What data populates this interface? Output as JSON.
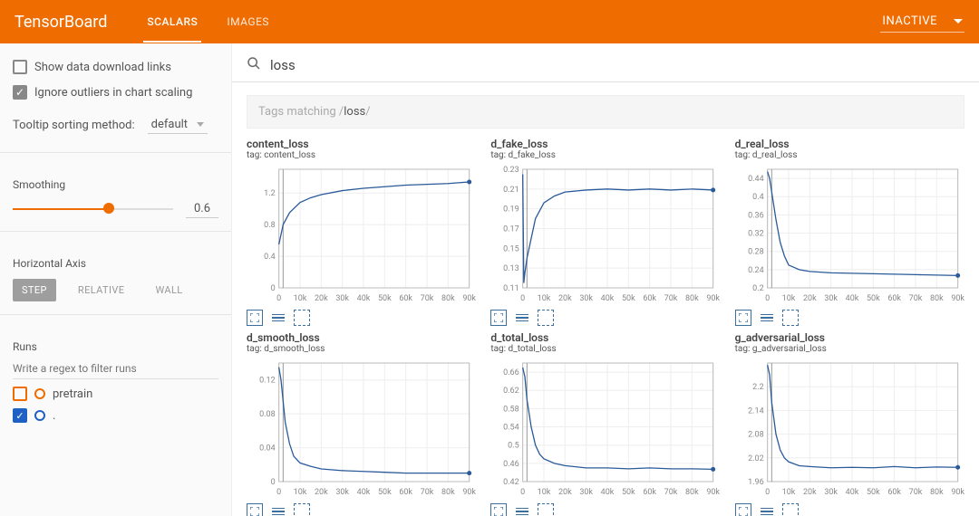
{
  "header": {
    "logo": "TensorBoard",
    "tabs": [
      {
        "label": "SCALARS",
        "active": true
      },
      {
        "label": "IMAGES",
        "active": false
      }
    ],
    "dropdown": "INACTIVE"
  },
  "sidebar": {
    "download_links": {
      "label": "Show data download links",
      "checked": false
    },
    "ignore_outliers": {
      "label": "Ignore outliers in chart scaling",
      "checked": true
    },
    "tooltip_label": "Tooltip sorting method:",
    "tooltip_value": "default",
    "smoothing_label": "Smoothing",
    "smoothing_value": "0.6",
    "smoothing_pct": 60,
    "horiz_label": "Horizontal Axis",
    "axis_options": [
      {
        "label": "STEP",
        "active": true
      },
      {
        "label": "RELATIVE",
        "active": false
      },
      {
        "label": "WALL",
        "active": false
      }
    ],
    "runs_label": "Runs",
    "runs_filter_placeholder": "Write a regex to filter runs",
    "runs": [
      {
        "name": "pretrain",
        "color": "orange",
        "checked": false
      },
      {
        "name": ".",
        "color": "blue",
        "checked": true
      }
    ]
  },
  "search": {
    "value": "loss"
  },
  "tagbar": {
    "prefix": "Tags matching /",
    "query": "loss",
    "suffix": "/"
  },
  "x_ticks": [
    "0",
    "10k",
    "20k",
    "30k",
    "40k",
    "50k",
    "60k",
    "70k",
    "80k",
    "90k"
  ],
  "chart_data": [
    {
      "title": "content_loss",
      "tag": "tag: content_loss",
      "type": "line",
      "xlabel": "",
      "ylabel": "",
      "x_ticks": [
        "0",
        "10k",
        "20k",
        "30k",
        "40k",
        "50k",
        "60k",
        "70k",
        "80k",
        "90k"
      ],
      "y_ticks": [
        "0",
        "0.4",
        "0.8",
        "1.2"
      ],
      "ylim": [
        0,
        1.5
      ],
      "x": [
        0,
        2,
        5,
        10,
        15,
        20,
        30,
        40,
        50,
        60,
        70,
        80,
        90
      ],
      "values": [
        0.55,
        0.8,
        0.95,
        1.08,
        1.14,
        1.18,
        1.23,
        1.26,
        1.28,
        1.3,
        1.31,
        1.32,
        1.34
      ]
    },
    {
      "title": "d_fake_loss",
      "tag": "tag: d_fake_loss",
      "type": "line",
      "x_ticks": [
        "0",
        "10k",
        "20k",
        "30k",
        "40k",
        "50k",
        "60k",
        "70k",
        "80k",
        "90k"
      ],
      "y_ticks": [
        "0.11",
        "0.13",
        "0.15",
        "0.17",
        "0.19",
        "0.21",
        "0.23"
      ],
      "ylim": [
        0.11,
        0.23
      ],
      "x": [
        0,
        0.5,
        1,
        2,
        4,
        6,
        10,
        15,
        20,
        30,
        40,
        50,
        60,
        70,
        80,
        90
      ],
      "values": [
        0.225,
        0.115,
        0.125,
        0.14,
        0.16,
        0.18,
        0.196,
        0.203,
        0.207,
        0.209,
        0.21,
        0.209,
        0.21,
        0.209,
        0.21,
        0.209
      ]
    },
    {
      "title": "d_real_loss",
      "tag": "tag: d_real_loss",
      "type": "line",
      "x_ticks": [
        "0",
        "10k",
        "20k",
        "30k",
        "40k",
        "50k",
        "60k",
        "70k",
        "80k",
        "90k"
      ],
      "y_ticks": [
        "0.2",
        "0.24",
        "0.28",
        "0.32",
        "0.36",
        "0.4",
        "0.44"
      ],
      "ylim": [
        0.2,
        0.46
      ],
      "x": [
        0,
        1,
        2,
        4,
        6,
        8,
        10,
        15,
        20,
        30,
        40,
        50,
        60,
        70,
        80,
        90
      ],
      "values": [
        0.455,
        0.44,
        0.41,
        0.35,
        0.3,
        0.27,
        0.25,
        0.24,
        0.236,
        0.233,
        0.232,
        0.231,
        0.23,
        0.229,
        0.228,
        0.227
      ]
    },
    {
      "title": "d_smooth_loss",
      "tag": "tag: d_smooth_loss",
      "type": "line",
      "x_ticks": [
        "0",
        "10k",
        "20k",
        "30k",
        "40k",
        "50k",
        "60k",
        "70k",
        "80k",
        "90k"
      ],
      "y_ticks": [
        "0",
        "0.04",
        "0.08",
        "0.12"
      ],
      "ylim": [
        0,
        0.14
      ],
      "x": [
        0,
        1,
        2,
        3,
        5,
        7,
        10,
        15,
        20,
        30,
        40,
        50,
        60,
        70,
        80,
        90
      ],
      "values": [
        0.135,
        0.12,
        0.095,
        0.07,
        0.045,
        0.03,
        0.022,
        0.018,
        0.015,
        0.013,
        0.012,
        0.011,
        0.01,
        0.01,
        0.01,
        0.01
      ]
    },
    {
      "title": "d_total_loss",
      "tag": "tag: d_total_loss",
      "type": "line",
      "x_ticks": [
        "0",
        "10k",
        "20k",
        "30k",
        "40k",
        "50k",
        "60k",
        "70k",
        "80k",
        "90k"
      ],
      "y_ticks": [
        "0.42",
        "0.46",
        "0.5",
        "0.54",
        "0.58",
        "0.62",
        "0.66"
      ],
      "ylim": [
        0.42,
        0.68
      ],
      "x": [
        0,
        1,
        2,
        4,
        6,
        8,
        10,
        15,
        20,
        30,
        40,
        50,
        60,
        70,
        80,
        90
      ],
      "values": [
        0.67,
        0.65,
        0.6,
        0.54,
        0.5,
        0.48,
        0.47,
        0.46,
        0.455,
        0.45,
        0.45,
        0.448,
        0.45,
        0.448,
        0.448,
        0.447
      ]
    },
    {
      "title": "g_adversarial_loss",
      "tag": "tag: g_adversarial_loss",
      "type": "line",
      "x_ticks": [
        "0",
        "10k",
        "20k",
        "30k",
        "40k",
        "50k",
        "60k",
        "70k",
        "80k",
        "90k"
      ],
      "y_ticks": [
        "1.96",
        "2.02",
        "2.08",
        "2.14",
        "2.2"
      ],
      "ylim": [
        1.96,
        2.26
      ],
      "x": [
        0,
        1,
        2,
        4,
        6,
        8,
        10,
        15,
        20,
        30,
        40,
        50,
        60,
        70,
        80,
        90
      ],
      "values": [
        2.255,
        2.23,
        2.16,
        2.08,
        2.04,
        2.02,
        2.01,
        2.0,
        1.998,
        1.995,
        1.996,
        1.995,
        1.998,
        1.995,
        1.997,
        1.996
      ]
    }
  ]
}
